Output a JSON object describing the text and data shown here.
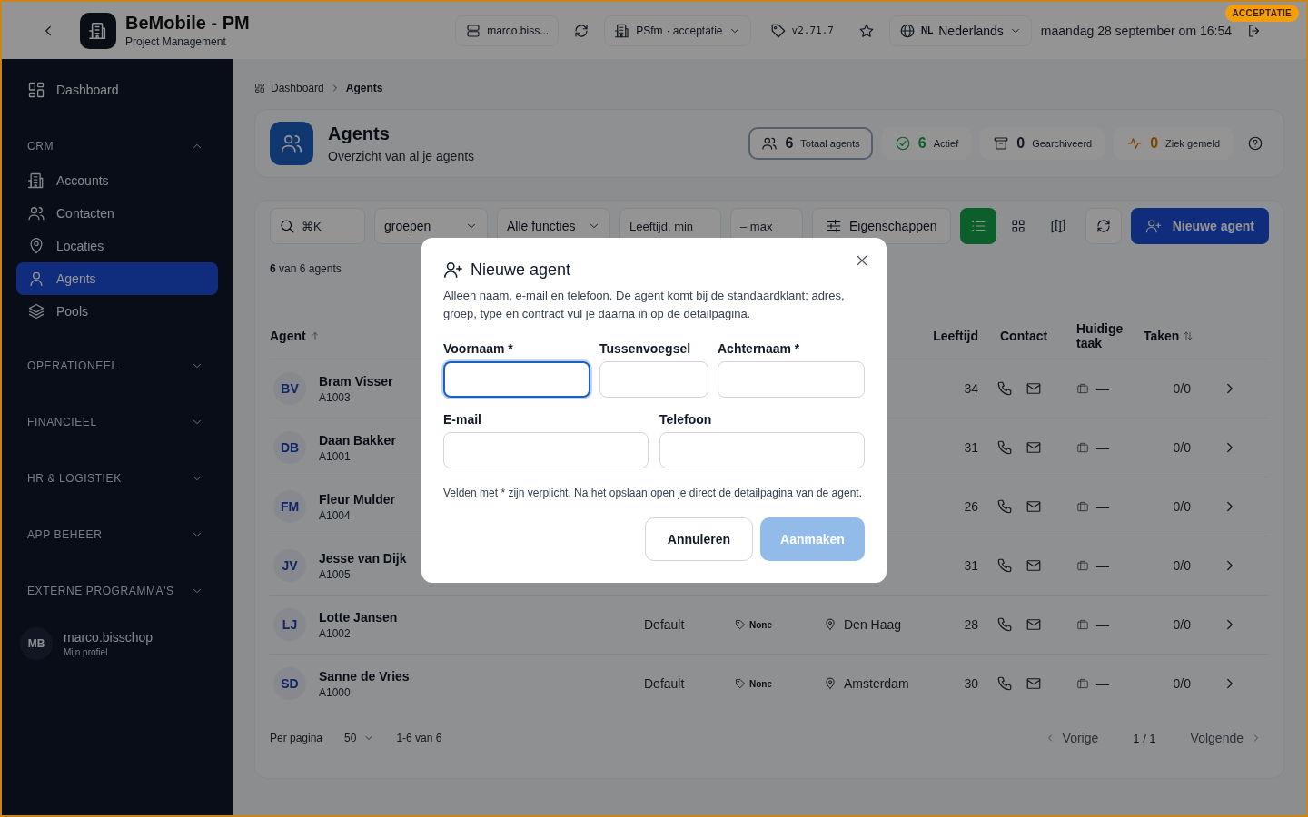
{
  "environment_badge": "ACCEPTATIE",
  "app": {
    "title": "BeMobile - PM",
    "subtitle": "Project Management"
  },
  "topbar": {
    "account": "marco.biss...",
    "environment": {
      "name": "PSfm",
      "detail": "· acceptatie"
    },
    "version": "v2.71.7",
    "language": {
      "code": "NL",
      "label": "Nederlands"
    },
    "datetime": "maandag 28 september om 16:54"
  },
  "sidebar": {
    "top_item": {
      "label": "Dashboard",
      "selected": false
    },
    "sections": [
      {
        "title": "CRM",
        "expanded": true,
        "items": [
          {
            "label": "Accounts",
            "selected": false
          },
          {
            "label": "Contacten",
            "selected": false
          },
          {
            "label": "Locaties",
            "selected": false
          },
          {
            "label": "Agents",
            "selected": true
          },
          {
            "label": "Pools",
            "selected": false
          }
        ]
      },
      {
        "title": "OPERATIONEEL",
        "expanded": false
      },
      {
        "title": "FINANCIEEL",
        "expanded": false
      },
      {
        "title": "HR & LOGISTIEK",
        "expanded": false
      },
      {
        "title": "APP BEHEER",
        "expanded": false
      },
      {
        "title": "EXTERNE PROGRAMMA'S",
        "expanded": false
      }
    ],
    "user": {
      "initials": "MB",
      "name": "marco.bisschop",
      "link": "Mijn profiel"
    }
  },
  "breadcrumb": [
    "Dashboard",
    "Agents"
  ],
  "page": {
    "title": "Agents",
    "subtitle": "Overzicht van al je agents"
  },
  "stats": [
    {
      "value": "6",
      "label": "Totaal agents",
      "selected": true
    },
    {
      "value": "6",
      "label": "Actief",
      "selected": false
    },
    {
      "value": "0",
      "label": "Gearchiveerd",
      "selected": false
    },
    {
      "value": "0",
      "label": "Ziek gemeld",
      "selected": false
    }
  ],
  "filters": {
    "search_placeholder": "⌘K",
    "group_select": "groepen",
    "function_select": "Alle functies",
    "age_min_placeholder": "Leeftijd, min",
    "age_max_placeholder": "– max",
    "properties_button": "Eigenschappen",
    "views": [
      {
        "kind": "list",
        "selected": true
      },
      {
        "kind": "grid",
        "selected": false
      },
      {
        "kind": "map",
        "selected": false
      }
    ],
    "new_button": "Nieuwe agent"
  },
  "count": "**6** van 6 agents",
  "table": {
    "columns": [
      "Agent",
      "Leeftijd",
      "Contact",
      "Huidige taak",
      "Taken"
    ],
    "rows": [
      {
        "initials": "BV",
        "name": "Bram Visser",
        "code": "A1003",
        "age": "34",
        "task": "—",
        "tasks": "0/0"
      },
      {
        "initials": "DB",
        "name": "Daan Bakker",
        "code": "A1001",
        "age": "31",
        "task": "—",
        "tasks": "0/0"
      },
      {
        "initials": "FM",
        "name": "Fleur Mulder",
        "code": "A1004",
        "age": "26",
        "task": "—",
        "tasks": "0/0"
      },
      {
        "initials": "JV",
        "name": "Jesse van Dijk",
        "code": "A1005",
        "age": "31",
        "task": "—",
        "tasks": "0/0"
      },
      {
        "initials": "LJ",
        "name": "Lotte Jansen",
        "code": "A1002",
        "group": "Default",
        "tag": "None",
        "location": "Den Haag",
        "age": "28",
        "task": "—",
        "tasks": "0/0"
      },
      {
        "initials": "SD",
        "name": "Sanne de Vries",
        "code": "A1000",
        "group": "Default",
        "tag": "None",
        "location": "Amsterdam",
        "age": "30",
        "task": "—",
        "tasks": "0/0"
      }
    ]
  },
  "pagination": {
    "per_page_label": "Per pagina",
    "per_page": "50",
    "range": "1-6 van 6",
    "previous": "Vorige",
    "page": "1 / 1",
    "next": "Volgende",
    "previous_disabled": true,
    "next_disabled": true
  },
  "dialog": {
    "title": "Nieuwe agent",
    "description": "Alleen naam, e-mail en telefoon. De agent komt bij de standaardklant; adres, groep, type en contract vul je daarna in op de detailpagina.",
    "field_rows": [
      [
        {
          "label": "Voornaam *",
          "focused": true
        },
        {
          "label": "Tussenvoegsel",
          "focused": false
        },
        {
          "label": "Achternaam *",
          "focused": false
        }
      ],
      [
        {
          "label": "E-mail",
          "focused": false
        },
        {
          "label": "Telefoon",
          "focused": false
        }
      ]
    ],
    "note": "Velden met * zijn verplicht. Na het opslaan open je direct de detailpagina van de agent.",
    "cancel": "Annuleren",
    "submit": {
      "label": "Aanmaken",
      "disabled": true
    }
  }
}
